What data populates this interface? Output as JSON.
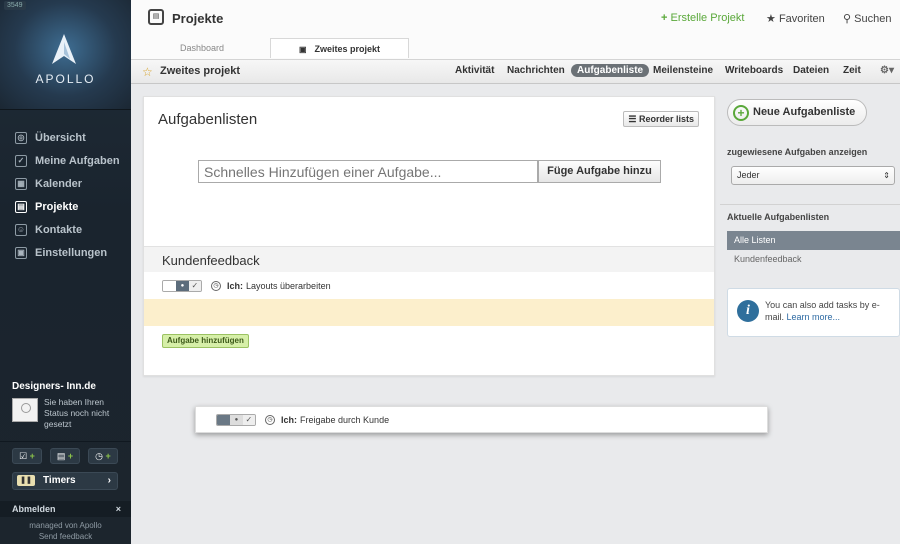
{
  "sidebar": {
    "badge": "3549",
    "logo_text": "APOLLO",
    "items": [
      {
        "label": "Übersicht",
        "icon": "eye-icon",
        "glyph": "◎"
      },
      {
        "label": "Meine Aufgaben",
        "icon": "checkbox-icon",
        "glyph": "✓"
      },
      {
        "label": "Kalender",
        "icon": "calendar-icon",
        "glyph": "▦"
      },
      {
        "label": "Projekte",
        "icon": "projects-icon",
        "glyph": "▤"
      },
      {
        "label": "Kontakte",
        "icon": "contacts-icon",
        "glyph": "☺"
      },
      {
        "label": "Einstellungen",
        "icon": "settings-icon",
        "glyph": "▣"
      }
    ],
    "company": "Designers- Inn.de",
    "status": "Sie haben Ihren Status noch nicht gesetzt",
    "timers_label": "Timers",
    "logout_label": "Abmelden",
    "footer_managed": "managed von Apollo",
    "footer_feedback": "Send feedback"
  },
  "header": {
    "title": "Projekte",
    "create_project": "Erstelle Projekt",
    "favorites": "Favoriten",
    "search": "Suchen",
    "tabs": [
      "Dashboard",
      "Zweites projekt"
    ]
  },
  "subnav": {
    "project_name": "Zweites projekt",
    "items": [
      "Aktivität",
      "Nachrichten",
      "Aufgabenliste",
      "Meilensteine",
      "Writeboards",
      "Dateien",
      "Zeit"
    ],
    "active": "Aufgabenliste"
  },
  "main": {
    "title": "Aufgabenlisten",
    "reorder_label": "Reorder lists",
    "quick_add_placeholder": "Schnelles Hinzufügen einer Aufgabe...",
    "quick_add_button": "Füge Aufgabe hinzu",
    "list_name": "Kundenfeedback",
    "task_owner": "Ich:",
    "task_text": "Layouts überarbeiten",
    "add_task_button": "Aufgabe hinzufügen",
    "dragged_task_owner": "Ich:",
    "dragged_task_text": "Freigabe durch Kunde"
  },
  "right": {
    "new_list_button": "Neue Aufgabenliste",
    "assigned_label": "zugewiesene Aufgaben anzeigen",
    "assigned_value": "Jeder",
    "current_lists_label": "Aktuelle Aufgabenlisten",
    "lists": [
      "Alle Listen",
      "Kundenfeedback"
    ],
    "info_text": "You can also add tasks by e-mail.",
    "info_link": "Learn more..."
  },
  "colors": {
    "sidebar_bg": "#1c252d",
    "accent_green": "#5aa83a",
    "active_pill": "#6b7176",
    "highlight_row": "#fcefcc"
  }
}
